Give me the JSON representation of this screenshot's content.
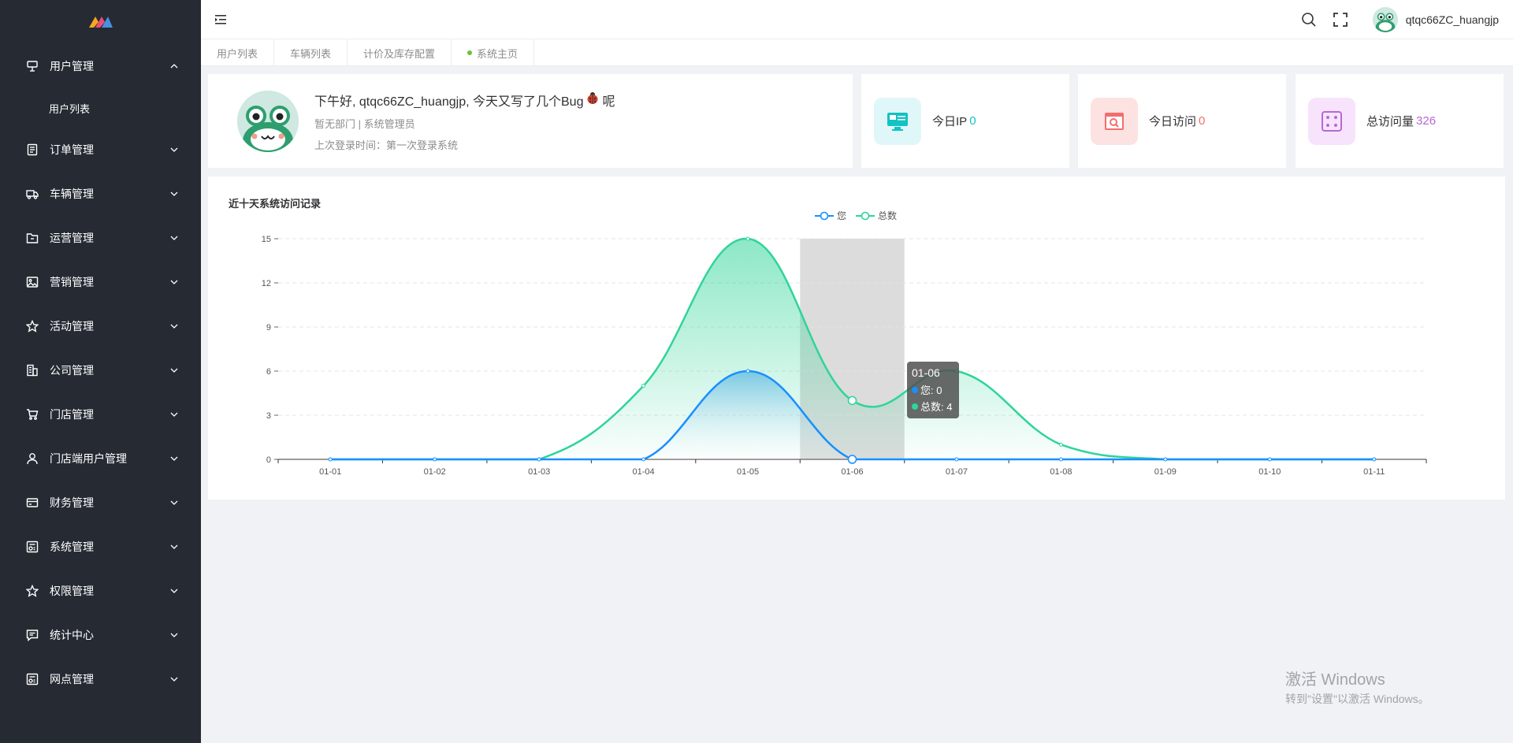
{
  "sidebar": {
    "items": [
      {
        "label": "用户管理",
        "icon": "desk-icon",
        "expanded": true,
        "children": [
          "用户列表"
        ]
      },
      {
        "label": "订单管理",
        "icon": "document-icon"
      },
      {
        "label": "车辆管理",
        "icon": "truck-icon"
      },
      {
        "label": "运营管理",
        "icon": "folder-icon"
      },
      {
        "label": "营销管理",
        "icon": "picture-icon"
      },
      {
        "label": "活动管理",
        "icon": "star-icon"
      },
      {
        "label": "公司管理",
        "icon": "office-building-icon"
      },
      {
        "label": "门店管理",
        "icon": "shopping-cart-icon"
      },
      {
        "label": "门店端用户管理",
        "icon": "user-icon"
      },
      {
        "label": "财务管理",
        "icon": "credit-card-icon"
      },
      {
        "label": "系统管理",
        "icon": "data-board-icon"
      },
      {
        "label": "权限管理",
        "icon": "star-icon"
      },
      {
        "label": "统计中心",
        "icon": "chat-icon"
      },
      {
        "label": "网点管理",
        "icon": "data-board-icon"
      }
    ]
  },
  "header": {
    "username": "qtqc66ZC_huangjp"
  },
  "tabs": [
    {
      "label": "用户列表",
      "active": false
    },
    {
      "label": "车辆列表",
      "active": false
    },
    {
      "label": "计价及库存配置",
      "active": false
    },
    {
      "label": "系统主页",
      "active": true
    }
  ],
  "welcome": {
    "greeting_prefix": "下午好, qtqc66ZC_huangjp, 今天又写了几个Bug",
    "greeting_suffix": "呢",
    "department": "暂无部门 | 系统管理员",
    "last_login_label": "上次登录时间：",
    "last_login_value": "第一次登录系统"
  },
  "stats": [
    {
      "label": "今日IP",
      "value": "0",
      "color": "#13c2c2",
      "bg": "#e0f7fa",
      "icon": "monitor-icon"
    },
    {
      "label": "今日访问",
      "value": "0",
      "color": "#f56c6c",
      "bg": "#fde2e2",
      "icon": "browser-search-icon"
    },
    {
      "label": "总访问量",
      "value": "326",
      "color": "#b768d6",
      "bg": "#f7e4fc",
      "icon": "grid-dots-icon"
    }
  ],
  "chart_data": {
    "type": "area",
    "title": "近十天系统访问记录",
    "categories": [
      "01-01",
      "01-02",
      "01-03",
      "01-04",
      "01-05",
      "01-06",
      "01-07",
      "01-08",
      "01-09",
      "01-10",
      "01-11"
    ],
    "series": [
      {
        "name": "您",
        "values": [
          0,
          0,
          0,
          0,
          6,
          0,
          0,
          0,
          0,
          0,
          0
        ],
        "color": "#1890ff"
      },
      {
        "name": "总数",
        "values": [
          0,
          0,
          0,
          5,
          15,
          4,
          6,
          1,
          0,
          0,
          0
        ],
        "color": "#2ed598"
      }
    ],
    "yticks": [
      0,
      3,
      6,
      9,
      12,
      15
    ],
    "ylim": [
      0,
      15
    ],
    "legend_position": "top-center",
    "grid": true,
    "highlighted_category": "01-06"
  },
  "tooltip": {
    "title": "01-06",
    "rows": [
      {
        "label": "您: 0",
        "color": "#1890ff"
      },
      {
        "label": "总数: 4",
        "color": "#2ed598"
      }
    ]
  },
  "watermark": {
    "line1": "激活 Windows",
    "line2": "转到\"设置\"以激活 Windows。"
  }
}
